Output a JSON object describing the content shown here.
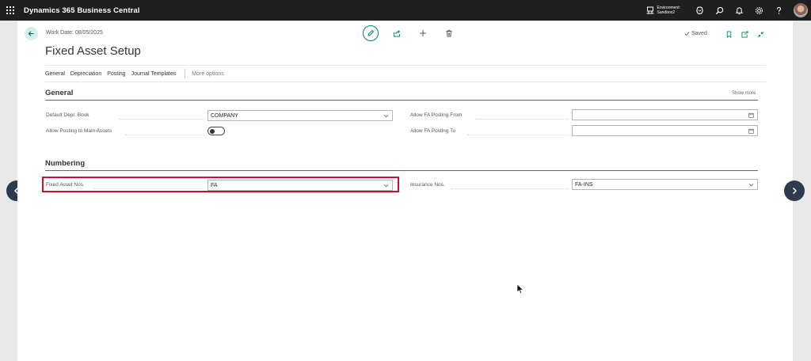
{
  "topbar": {
    "app_title": "Dynamics 365 Business Central",
    "environment_label": "Environment:",
    "environment_name": "Sandbox2"
  },
  "header": {
    "work_date": "Work Date: 08/05/2025",
    "title": "Fixed Asset Setup",
    "status": "Saved"
  },
  "tabs": [
    {
      "label": "General"
    },
    {
      "label": "Depreciation"
    },
    {
      "label": "Posting"
    },
    {
      "label": "Journal Templates"
    }
  ],
  "more_options": "More options",
  "general": {
    "title": "General",
    "show_more": "Show more",
    "default_depr_book": {
      "label": "Default Depr. Book",
      "value": "COMPANY"
    },
    "allow_posting_main": {
      "label": "Allow Posting to Main Assets",
      "value": false
    },
    "allow_fa_from": {
      "label": "Allow FA Posting From",
      "value": ""
    },
    "allow_fa_to": {
      "label": "Allow FA Posting To",
      "value": ""
    }
  },
  "numbering": {
    "title": "Numbering",
    "fixed_asset_nos": {
      "label": "Fixed Asset Nos.",
      "value": "FA"
    },
    "insurance_nos": {
      "label": "Insurance Nos.",
      "value": "FA-INS"
    }
  },
  "colors": {
    "topbar": "#1f1f1f",
    "accent": "#008575",
    "highlight": "#c8102e",
    "nav_button": "#2e3b4e"
  },
  "icons": {
    "app_launcher": "waffle-icon",
    "environment": "environment-icon",
    "copilot": "copilot-icon",
    "search": "search-icon",
    "notifications": "bell-icon",
    "settings": "gear-icon",
    "help": "help-icon",
    "back": "arrow-left-icon",
    "edit": "pencil-icon",
    "share": "share-icon",
    "new": "plus-icon",
    "delete": "trash-icon",
    "bookmark": "bookmark-icon",
    "open_new_window": "open-new-window-icon",
    "collapse": "collapse-icon"
  }
}
